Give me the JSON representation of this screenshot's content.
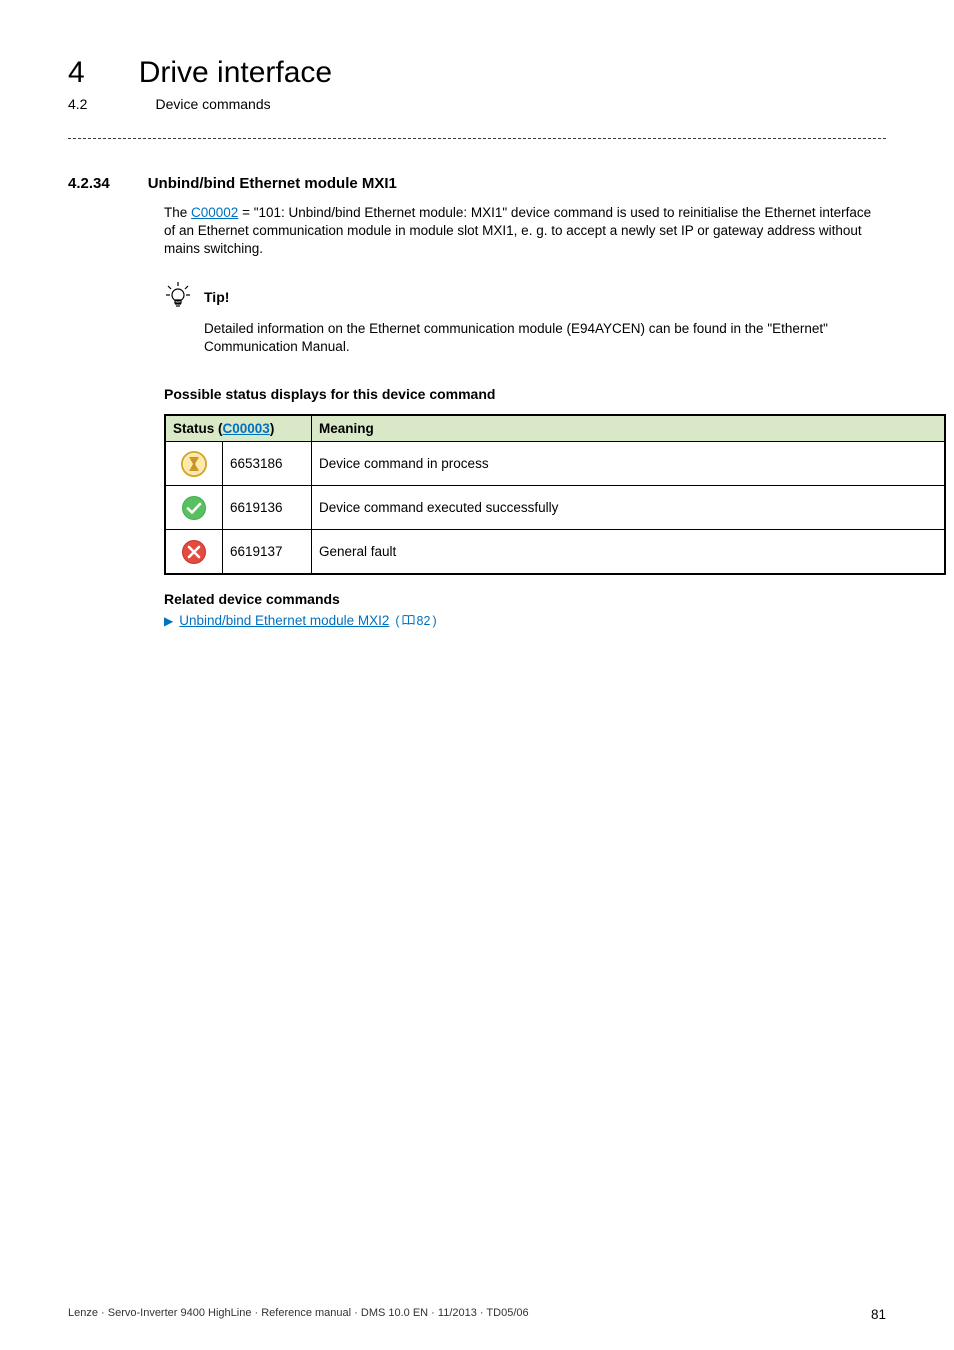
{
  "chapter": {
    "num": "4",
    "title": "Drive interface"
  },
  "subsection": {
    "num": "4.2",
    "title": "Device commands"
  },
  "section": {
    "num": "4.2.34",
    "title": "Unbind/bind Ethernet module MXI1"
  },
  "intro": {
    "pre": "The ",
    "code_link": "C00002",
    "mid": " = \"101: Unbind/bind Ethernet module: MXI1\" device command is used to reinitialise the Ethernet interface of an Ethernet communication module in module slot MXI1, e. g. to accept a newly set IP or gateway address without mains switching."
  },
  "tip": {
    "label": "Tip!",
    "text": "Detailed information on the Ethernet communication module (E94AYCEN) can be found in the \"Ethernet\" Communication Manual."
  },
  "status_table": {
    "heading": "Possible status displays for this device command",
    "header_col1_pre": "Status (",
    "header_col1_link": "C00003",
    "header_col1_post": ")",
    "header_col2": "Meaning",
    "rows": [
      {
        "icon": "hourglass",
        "code": "6653186",
        "meaning": "Device command in process"
      },
      {
        "icon": "check",
        "code": "6619136",
        "meaning": "Device command executed successfully"
      },
      {
        "icon": "cross",
        "code": "6619137",
        "meaning": "General fault"
      }
    ]
  },
  "related": {
    "heading": "Related device commands",
    "link_text": "Unbind/bind Ethernet module MXI2",
    "page_ref": "82"
  },
  "footer": {
    "left": "Lenze · Servo-Inverter 9400 HighLine · Reference manual · DMS 10.0 EN · 11/2013 · TD05/06",
    "page": "81"
  },
  "icons": {
    "lightbulb": "lightbulb-icon",
    "hourglass": "hourglass-icon",
    "check": "check-icon",
    "cross": "cross-icon",
    "book": "book-icon",
    "arrow": "right-arrow-icon"
  }
}
